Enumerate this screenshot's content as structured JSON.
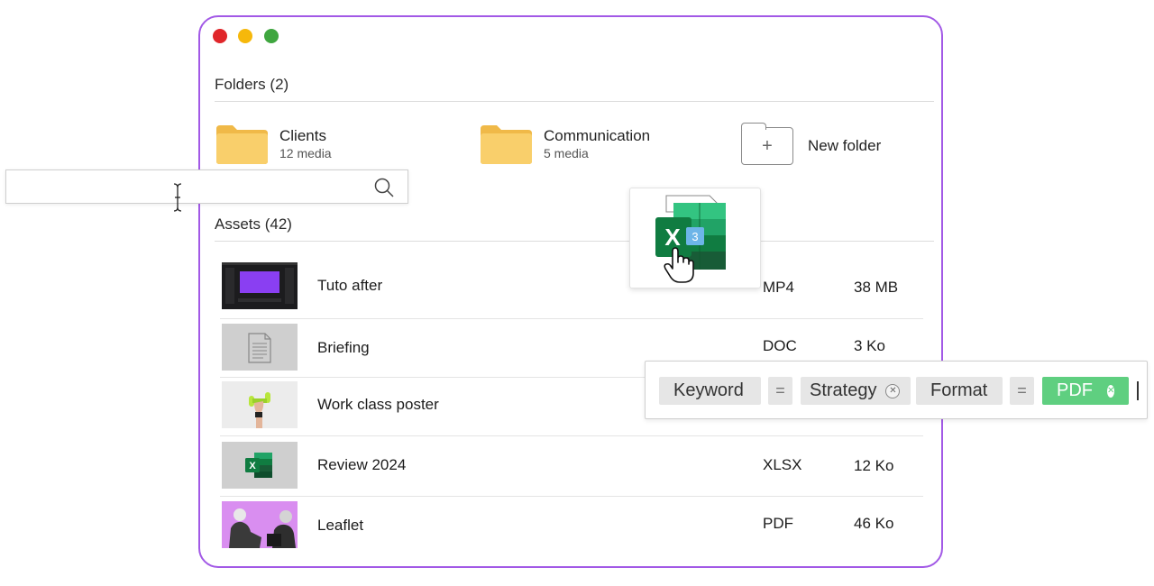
{
  "window": {
    "controls": [
      "close-dot",
      "minimize-dot",
      "maximize-dot"
    ]
  },
  "folders": {
    "title": "Folders (2)",
    "items": [
      {
        "name": "Clients",
        "count": "12 media"
      },
      {
        "name": "Communication",
        "count": "5 media"
      }
    ],
    "new_folder_label": "New folder",
    "new_folder_symbol": "+"
  },
  "assets": {
    "title": "Assets (42)",
    "rows": [
      {
        "name": "Tuto after",
        "format": "MP4",
        "size": "38 MB"
      },
      {
        "name": "Briefing",
        "format": "DOC",
        "size": "3 Ko"
      },
      {
        "name": "Work class poster",
        "format": "",
        "size": ""
      },
      {
        "name": "Review 2024",
        "format": "XLSX",
        "size": "12 Ko"
      },
      {
        "name": "Leaflet",
        "format": "PDF",
        "size": "46 Ko"
      }
    ]
  },
  "search": {
    "value": "",
    "icon": "search-icon"
  },
  "filters": {
    "chips": [
      {
        "label": "Keyword"
      },
      {
        "label": "="
      },
      {
        "label": "Strategy"
      },
      {
        "label": "Format"
      },
      {
        "label": "="
      },
      {
        "label": "PDF"
      }
    ]
  },
  "drag": {
    "badge": "3",
    "icon": "excel-file-icon",
    "cursor": "hand-pointer-icon"
  },
  "colors": {
    "accent": "#a259e6",
    "folder": "#f9cf6b",
    "filter_active": "#5fcf80",
    "excel_dark": "#107c41",
    "excel_badge": "#6db5e8"
  }
}
